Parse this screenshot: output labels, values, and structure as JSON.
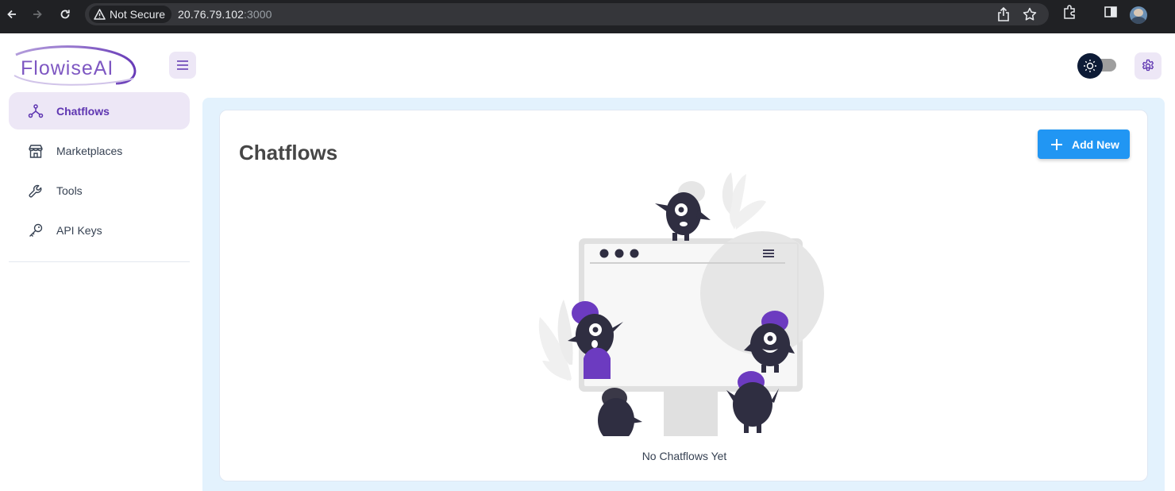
{
  "browser": {
    "security_label": "Not Secure",
    "url_host": "20.76.79.102",
    "url_port": ":3000"
  },
  "app": {
    "logo_text": "FlowiseAI",
    "accent_color": "#5e35b1",
    "primary_button_color": "#2196f3"
  },
  "sidebar": {
    "items": [
      {
        "label": "Chatflows",
        "icon": "hierarchy-icon",
        "active": true
      },
      {
        "label": "Marketplaces",
        "icon": "building-store-icon",
        "active": false
      },
      {
        "label": "Tools",
        "icon": "tool-icon",
        "active": false
      },
      {
        "label": "API Keys",
        "icon": "key-icon",
        "active": false
      }
    ]
  },
  "main": {
    "title": "Chatflows",
    "add_button_label": "Add New",
    "empty_message": "No Chatflows Yet"
  }
}
